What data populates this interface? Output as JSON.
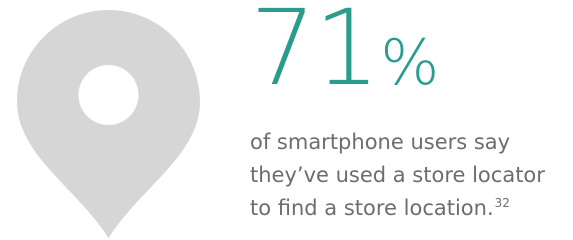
{
  "colors": {
    "accent": "#2a9c8e",
    "body_text": "#6d6d6d",
    "pin_fill": "#d6d6d6",
    "pin_hole": "#ffffff",
    "background": "#ffffff"
  },
  "icon": "map-pin-icon",
  "stat": {
    "value": "71",
    "unit": "%"
  },
  "caption": {
    "lines": [
      "of smartphone users say",
      "they’ve used a store locator",
      "to find a store location."
    ],
    "footnote": "32"
  }
}
